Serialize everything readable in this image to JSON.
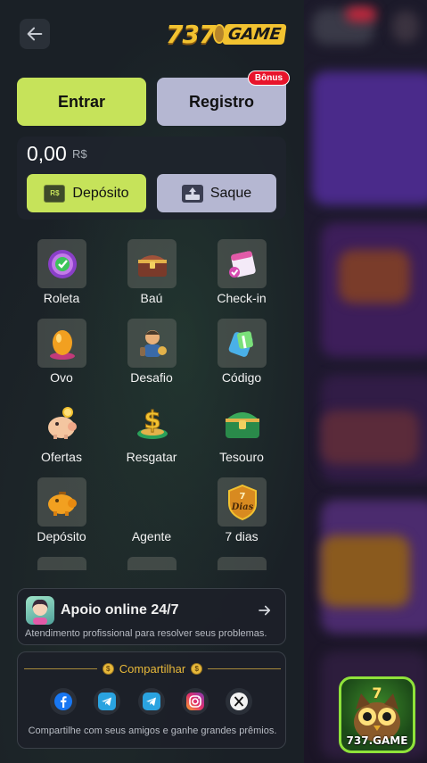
{
  "header": {
    "back_icon": "arrow-left-icon",
    "logo_number": "737",
    "logo_word": "GAME"
  },
  "auth": {
    "login_label": "Entrar",
    "register_label": "Registro",
    "bonus_badge": "Bônus"
  },
  "wallet": {
    "balance": "0,00",
    "currency": "R$",
    "deposit_label": "Depósito",
    "deposit_icon_text": "R$",
    "withdraw_label": "Saque"
  },
  "menu": {
    "items": [
      {
        "label": "Roleta",
        "icon": "roulette-wheel-icon"
      },
      {
        "label": "Baú",
        "icon": "treasure-chest-icon"
      },
      {
        "label": "Check-in",
        "icon": "calendar-check-icon"
      },
      {
        "label": "Ovo",
        "icon": "golden-egg-icon"
      },
      {
        "label": "Desafio",
        "icon": "challenge-character-icon"
      },
      {
        "label": "Código",
        "icon": "gift-code-icon"
      },
      {
        "label": "Ofertas",
        "icon": "piggy-bank-icon"
      },
      {
        "label": "Resgatar",
        "icon": "dollar-coin-icon"
      },
      {
        "label": "Tesouro",
        "icon": "green-chest-icon"
      },
      {
        "label": "Depósito",
        "icon": "gold-piggy-icon"
      },
      {
        "label": "Agente",
        "icon": "agent-icon"
      },
      {
        "label": "7 dias",
        "icon": "seven-days-shield-icon",
        "icon_text": "Dias",
        "icon_num": "7"
      }
    ]
  },
  "support": {
    "title": "Apoio online 24/7",
    "subtitle": "Atendimento profissional para resolver seus problemas.",
    "arrow_icon": "arrow-right-icon"
  },
  "share": {
    "title": "Compartilhar",
    "coin_symbol": "$",
    "subtitle": "Compartilhe com seus amigos e ganhe grandes prêmios.",
    "networks": [
      "facebook-icon",
      "telegram-icon",
      "telegram-icon",
      "instagram-icon",
      "x-icon"
    ]
  },
  "floating_badge": {
    "number": "7",
    "label": "737.GAME"
  },
  "colors": {
    "accent_green": "#c6e35a",
    "accent_lavender": "#b5b7d2",
    "bonus_red": "#e8142b",
    "gold": "#e7b83a"
  }
}
